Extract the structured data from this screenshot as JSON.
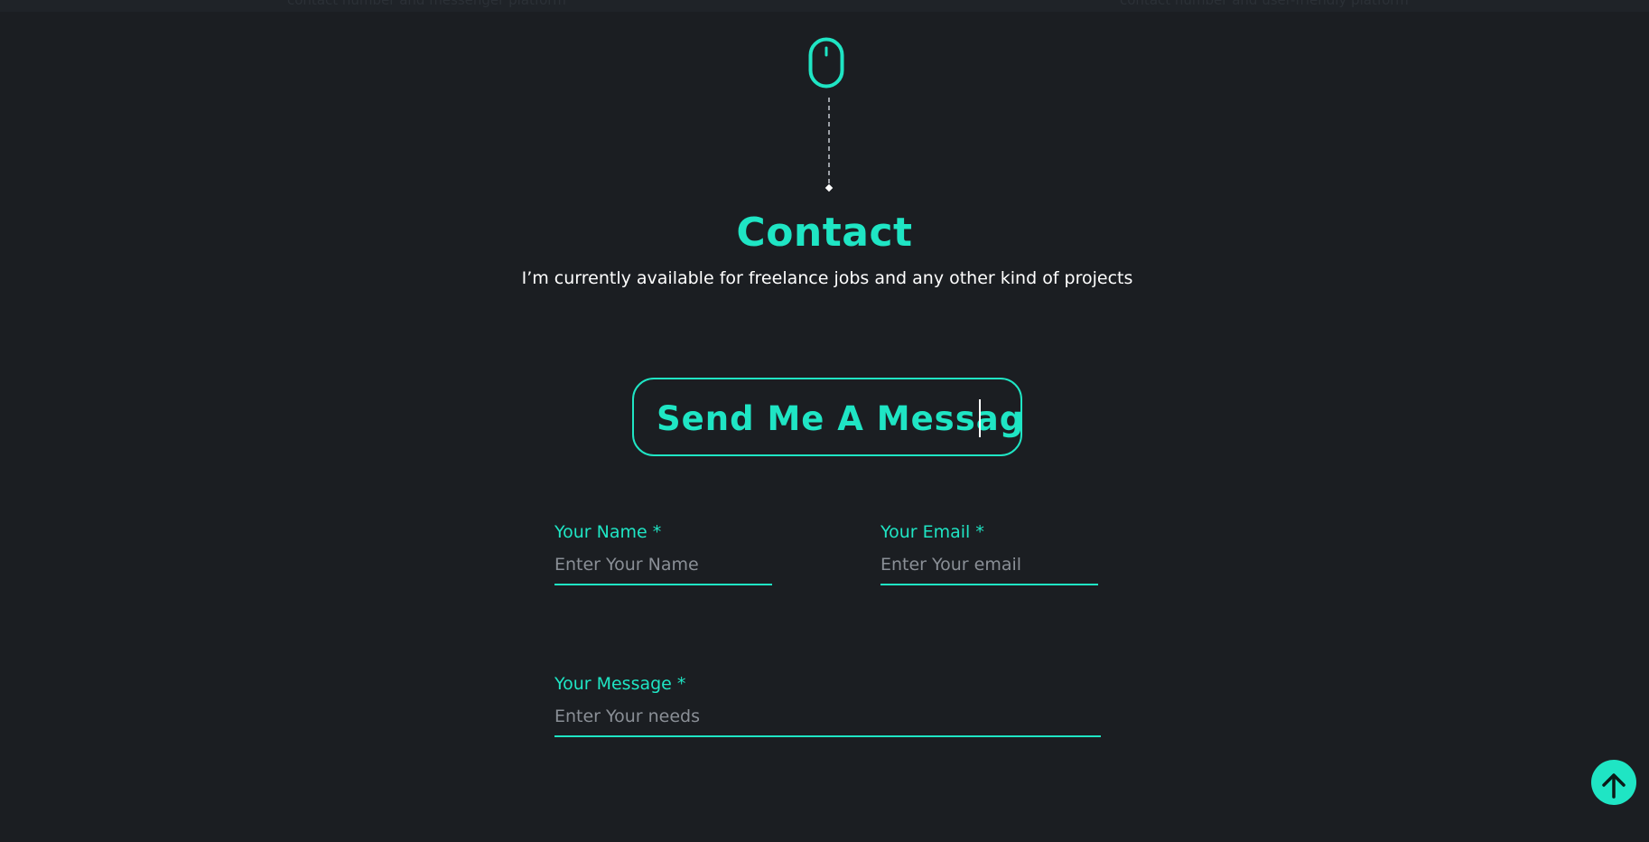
{
  "header_strip": {
    "fragment_left": "contact number and messenger platform",
    "fragment_right": "contact number and user-friendly platform"
  },
  "contact": {
    "title": "Contact",
    "subtitle": "I’m currently available for freelance jobs and any other kind of projects",
    "typing_text": "Send Me A Messag"
  },
  "form": {
    "name": {
      "label": "Your Name *",
      "placeholder": "Enter Your Name",
      "value": ""
    },
    "email": {
      "label": "Your Email *",
      "placeholder": "Enter Your email",
      "value": ""
    },
    "message": {
      "label": "Your Message *",
      "placeholder": "Enter Your needs",
      "value": ""
    }
  },
  "icons": {
    "scroll_indicator": "mouse-icon",
    "back_to_top": "arrow-up-icon"
  },
  "colors": {
    "background": "#1b1e22",
    "accent": "#1fe5c4",
    "text": "#ffffff",
    "placeholder": "#8a8f96"
  }
}
